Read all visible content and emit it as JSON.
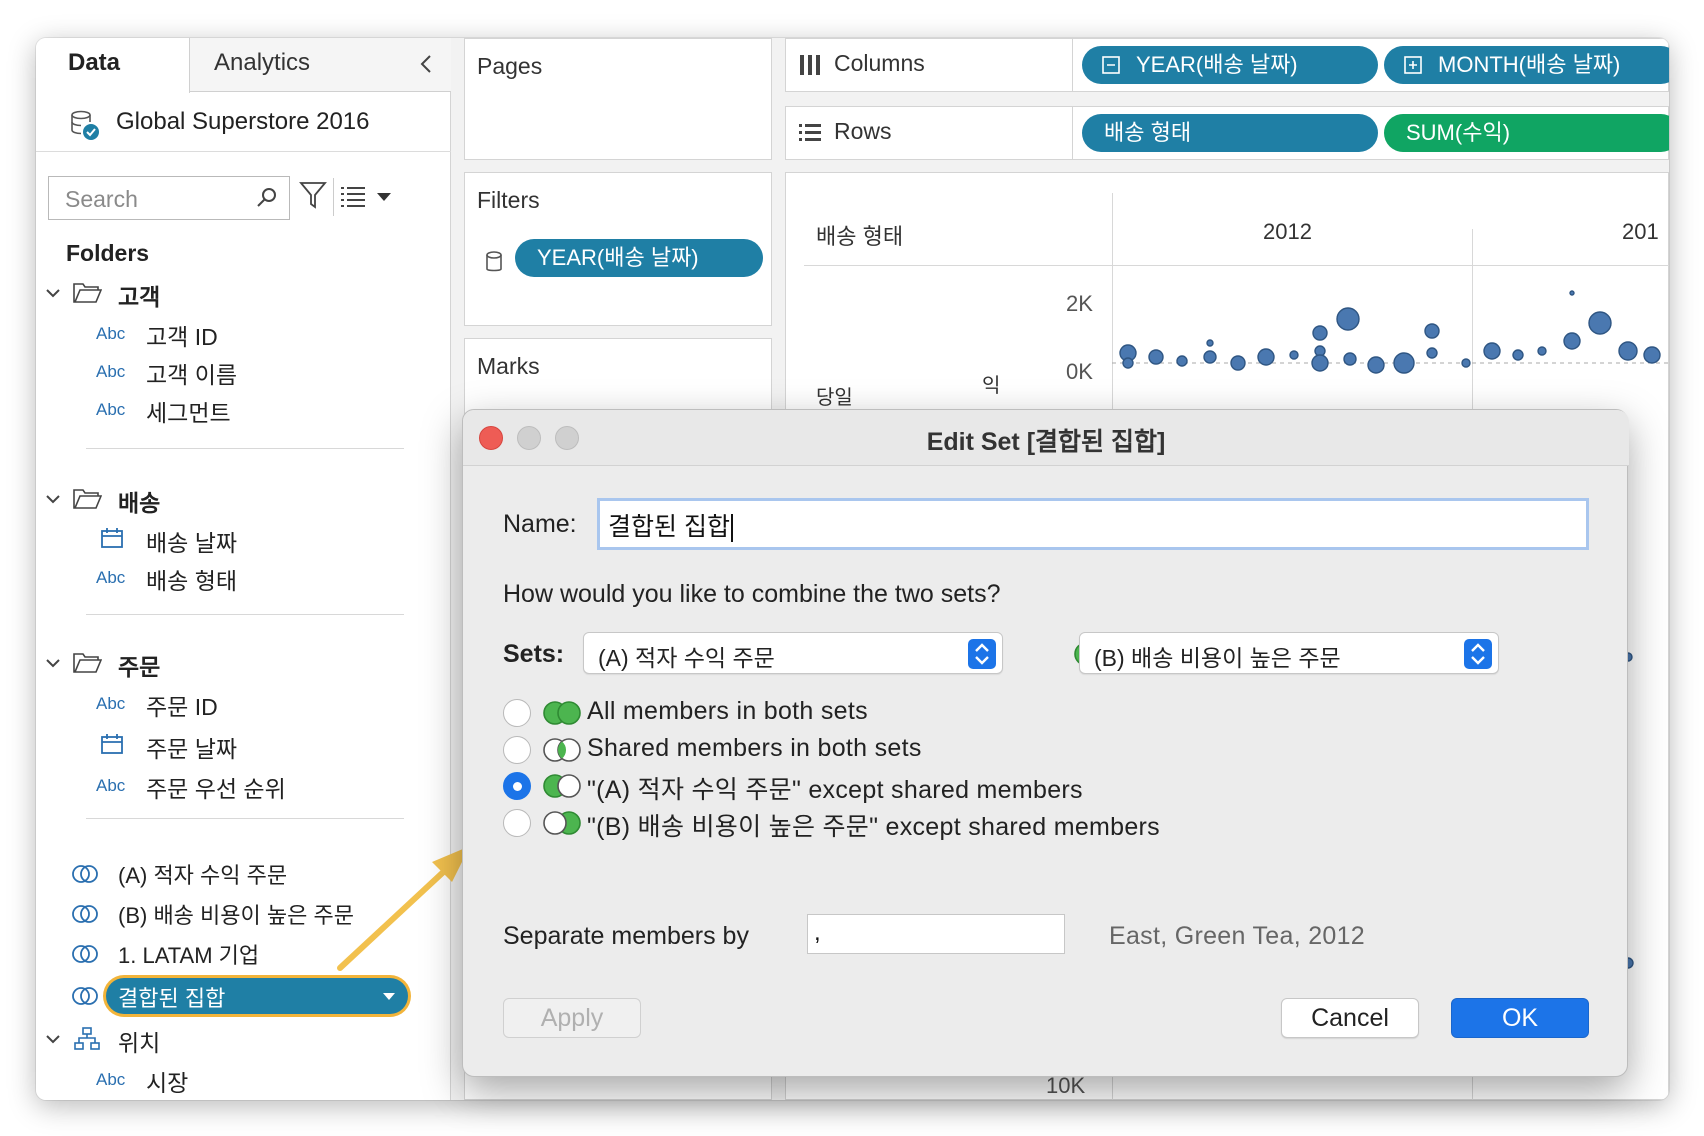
{
  "left_pane": {
    "tabs": {
      "data": "Data",
      "analytics": "Analytics"
    },
    "datasource": "Global Superstore 2016",
    "search_placeholder": "Search",
    "folders_label": "Folders",
    "folders": [
      {
        "name": "고객",
        "fields": [
          {
            "type": "Abc",
            "name": "고객 ID"
          },
          {
            "type": "Abc",
            "name": "고객 이름"
          },
          {
            "type": "Abc",
            "name": "세그먼트"
          }
        ]
      },
      {
        "name": "배송",
        "fields": [
          {
            "type": "date",
            "name": "배송 날짜"
          },
          {
            "type": "Abc",
            "name": "배송 형태"
          }
        ]
      },
      {
        "name": "주문",
        "fields": [
          {
            "type": "date",
            "name": "주문 날짜"
          },
          {
            "type": "Abc",
            "name": "주문 ID"
          },
          {
            "type": "Abc",
            "name": "주문 우선 순위"
          }
        ]
      }
    ],
    "sets": [
      "(A) 적자 수익 주문",
      "(B) 배송 비용이 높은 주문",
      "1. LATAM 기업",
      "결합된 집합"
    ],
    "location_folder": "위치",
    "location_field": {
      "type": "Abc",
      "name": "시장"
    }
  },
  "pages_card": {
    "title": "Pages"
  },
  "filters_card": {
    "title": "Filters",
    "pill": "YEAR(배송 날짜)"
  },
  "marks_card": {
    "title": "Marks"
  },
  "columns_shelf": {
    "label": "Columns",
    "pills": [
      "YEAR(배송 날짜)",
      "MONTH(배송 날짜)"
    ]
  },
  "rows_shelf": {
    "label": "Rows",
    "pills": [
      "배송 형태",
      "SUM(수익)"
    ]
  },
  "viz": {
    "row_header": "배송 형태",
    "years": [
      "2012",
      "201"
    ],
    "ticks": [
      "2K",
      "0K",
      "10K"
    ],
    "row_label_partial": "당일",
    "row_label_vertical": "익"
  },
  "dialog": {
    "title": "Edit Set [결합된 집합]",
    "name_label": "Name:",
    "name_value": "결합된 집합",
    "question": "How would you like to combine the two sets?",
    "sets_label": "Sets:",
    "set_a": "(A) 적자 수익 주문",
    "set_b": "(B) 배송 비용이 높은 주문",
    "options": [
      {
        "label": "All members in both sets",
        "checked": false
      },
      {
        "label": "Shared members in both sets",
        "checked": false
      },
      {
        "label": "\"(A) 적자 수익 주문\" except shared members",
        "checked": true
      },
      {
        "label": "\"(B) 배송 비용이 높은 주문\" except shared members",
        "checked": false
      }
    ],
    "separate_label": "Separate members by",
    "separate_value": ",",
    "separate_preview": "East, Green Tea, 2012",
    "apply": "Apply",
    "cancel": "Cancel",
    "ok": "OK"
  },
  "colors": {
    "pill_blue": "#1f7fa5",
    "pill_green": "#10a563",
    "accent_blue": "#1c74e8",
    "highlight": "#f2b43a",
    "mark_blue": "#4a78b0"
  }
}
